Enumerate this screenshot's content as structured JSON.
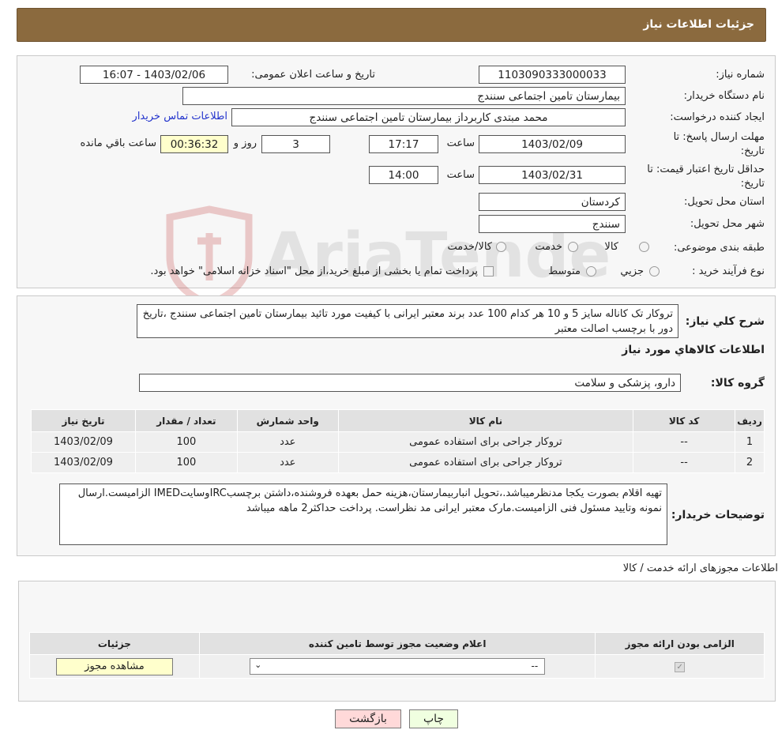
{
  "header": {
    "title": "جزئیات اطلاعات نیاز"
  },
  "form": {
    "need_number_label": "شماره نیاز:",
    "need_number": "1103090333000033",
    "announce_label": "تاریخ و ساعت اعلان عمومی:",
    "announce_value": "1403/02/06 - 16:07",
    "buyer_org_label": "نام دستگاه خریدار:",
    "buyer_org": "بیمارستان تامین اجتماعی سنندج",
    "requester_label": "ایجاد کننده درخواست:",
    "requester": "محمد مبتدی کاربرداز بیمارستان تامین اجتماعی سنندج",
    "contact_link": "اطلاعات تماس خریدار",
    "deadline_label_1": "مهلت ارسال پاسخ: تا",
    "deadline_label_2": "تاریخ:",
    "deadline_date": "1403/02/09",
    "time_label": "ساعت",
    "deadline_time": "17:17",
    "days_value": "3",
    "days_label": "روز و",
    "remaining_time": "00:36:32",
    "remaining_label": "ساعت باقي مانده",
    "validity_label_1": "حداقل تاریخ اعتبار قیمت: تا",
    "validity_label_2": "تاریخ:",
    "validity_date": "1403/02/31",
    "validity_time_label": "ساعت",
    "validity_time": "14:00",
    "province_label": "استان محل تحویل:",
    "province": "کردستان",
    "city_label": "شهر محل تحویل:",
    "city": "سنندج",
    "category_label": "طبقه بندی موضوعی:",
    "category_options": [
      "کالا",
      "خدمت",
      "کالا/خدمت"
    ],
    "process_label": "نوع فرآیند خرید :",
    "process_options": [
      "جزیي",
      "متوسط"
    ],
    "process_note": "پرداخت تمام یا بخشی از مبلغ خرید،از محل \"اسناد خزانه اسلامی\" خواهد بود."
  },
  "description": {
    "label": "شرح کلي نیاز:",
    "text": "تروکار تک کاناله سایز 5 و 10 هر کدام 100 عدد برند معتبر ایرانی با کیفیت مورد تائید بیمارستان تامین اجتماعی سنندج ،تاریخ دور با برچسب اصالت معتبر",
    "goods_info_title": "اطلاعات کالاهاي مورد نیاز",
    "goods_group_label": "گروه کالا:",
    "goods_group": "دارو، پزشکی و سلامت"
  },
  "goods_table": {
    "headers": [
      "ردیف",
      "کد کالا",
      "نام کالا",
      "واحد شمارش",
      "تعداد / مقدار",
      "تاریخ نیاز"
    ],
    "rows": [
      [
        "1",
        "--",
        "تروکار جراحی برای استفاده عمومی",
        "عدد",
        "100",
        "1403/02/09"
      ],
      [
        "2",
        "--",
        "تروکار جراحی برای استفاده عمومی",
        "عدد",
        "100",
        "1403/02/09"
      ]
    ]
  },
  "buyer_notes": {
    "label": "توضیحات خریدار:",
    "text": "تهیه اقلام بصورت یکجا مدنظرمیباشد.،تحویل انباربیمارستان،هزینه حمل بعهده فروشنده،داشتن برچسبIRCوسایتIMED الزامیست.ارسال نمونه وتایید مسئول فنی الزامیست.مارک معتبر ایرانی مد نظراست. پرداخت حداکثر2 ماهه میباشد"
  },
  "licenses": {
    "title": "اطلاعات مجوزهای ارائه خدمت / کالا",
    "headers": [
      "الزامی بودن ارائه مجوز",
      "اعلام وضعیت مجوز توسط تامین کننده",
      "جزئیات"
    ],
    "select_value": "--",
    "view_button": "مشاهده مجوز"
  },
  "buttons": {
    "print": "چاپ",
    "back": "بازگشت"
  },
  "watermark": {
    "text": "AriaTender.neT"
  }
}
